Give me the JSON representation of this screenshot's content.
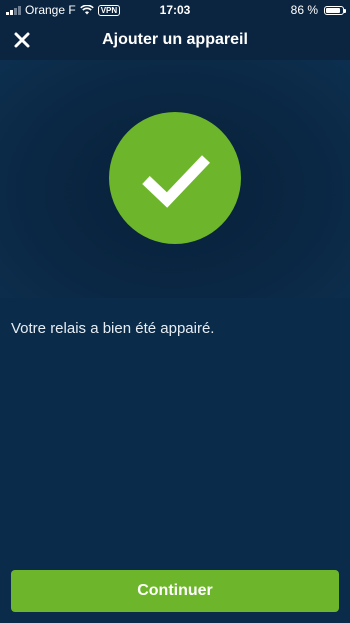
{
  "status_bar": {
    "carrier": "Orange F",
    "vpn_label": "VPN",
    "time": "17:03",
    "battery_text": "86 %",
    "battery_level": 0.86,
    "signal_bars": 2,
    "signal_bars_total": 4
  },
  "header": {
    "title": "Ajouter un appareil",
    "close_icon": "close-icon"
  },
  "success": {
    "icon": "checkmark-icon",
    "message": "Votre relais a bien été appairé."
  },
  "footer": {
    "continue_label": "Continuer"
  },
  "colors": {
    "accent": "#6db52a",
    "background": "#0b2b4a",
    "header_background": "#0b2540"
  }
}
